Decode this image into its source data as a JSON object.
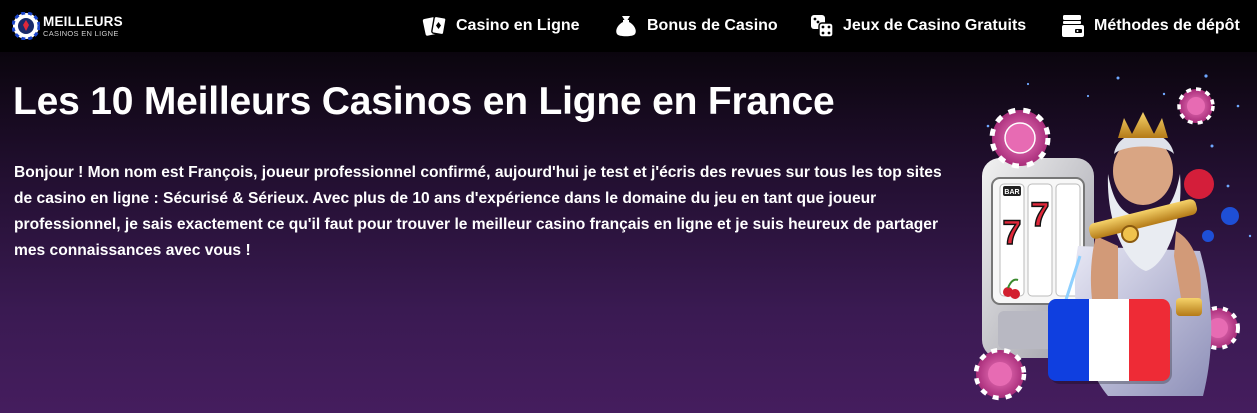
{
  "header": {
    "logo": {
      "main": "MEILLEURS",
      "sub": "CASINOS EN LIGNE"
    },
    "nav": [
      {
        "label": "Casino en Ligne",
        "icon": "playing-cards-icon"
      },
      {
        "label": "Bonus de Casino",
        "icon": "money-bag-icon"
      },
      {
        "label": "Jeux de Casino Gratuits",
        "icon": "dice-icon"
      },
      {
        "label": "Méthodes de dépôt",
        "icon": "card-wallet-icon"
      }
    ]
  },
  "main": {
    "title": "Les 10 Meilleurs Casinos en Ligne en France",
    "intro": "Bonjour ! Mon nom est François, joueur professionnel confirmé, aujourd'hui je test et j'écris des revues sur tous les top sites de casino en ligne : Sécurisé & Sérieux. Avec plus de 10 ans d'expérience dans le domaine du jeu en tant que joueur professionnel, je sais exactement ce qu'il faut pour trouver le meilleur casino français en ligne et je suis heureux de partager mes connaissances avec vous !"
  },
  "hero": {
    "slot_symbols": [
      "BAR",
      "7",
      "7"
    ],
    "colors": {
      "flag_blue": "#0f3fe0",
      "flag_white": "#ffffff",
      "flag_red": "#ee2b36",
      "chip_pink": "#d94ea0",
      "gold": "#e0a631"
    }
  }
}
